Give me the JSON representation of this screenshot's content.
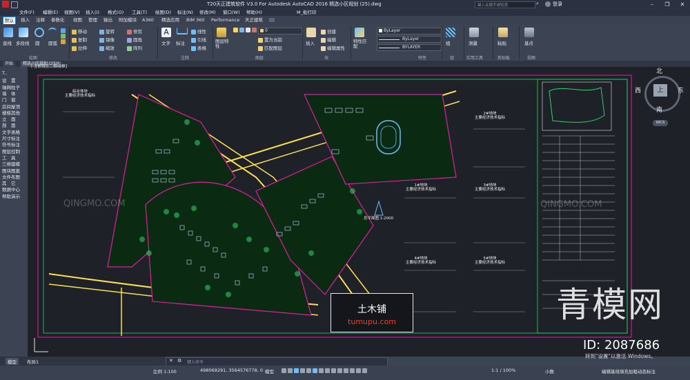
{
  "titlebar": {
    "title": "T20天正建筑软件 V3.0 For Autodesk AutoCAD 2016    精选小区规划 (25).dwg",
    "search_placeholder": "键入关键字或短语",
    "login": "登录",
    "minimize": "–",
    "maximize": "❐",
    "close": "✕"
  },
  "menubar": [
    "文件(F)",
    "编辑(E)",
    "视图(V)",
    "插入(I)",
    "格式(O)",
    "工具(T)",
    "绘图(D)",
    "标注(N)",
    "修改(M)",
    "窗口(W)",
    "帮助(H)",
    "M_批打印"
  ],
  "tabs": [
    "默认",
    "插入",
    "注释",
    "参数化",
    "视图",
    "管理",
    "输出",
    "附加模块",
    "A360",
    "精选应用",
    "BIM 360",
    "Performance",
    "天正建筑"
  ],
  "ribbon": {
    "draw_tools": [
      {
        "label": "直线",
        "icon": "line-icon"
      },
      {
        "label": "多段线",
        "icon": "polyline-icon"
      },
      {
        "label": "圆",
        "icon": "circle-icon"
      },
      {
        "label": "圆弧",
        "icon": "arc-icon"
      }
    ],
    "modify_tools": [
      [
        "移动",
        "旋转",
        "修剪"
      ],
      [
        "复制",
        "镜像",
        "圆角"
      ],
      [
        "拉伸",
        "缩放",
        "阵列"
      ]
    ],
    "annotation_tools": [
      {
        "label": "文字",
        "icon": "text-icon"
      },
      {
        "label": "标注",
        "icon": "dimension-icon"
      }
    ],
    "annotation_small": [
      "线性",
      "引线",
      "表格"
    ],
    "layer_tools": {
      "big": "图层特性",
      "small": [
        "置为当前",
        "匹配图层"
      ],
      "layer_value": "0"
    },
    "block_tools": {
      "big": "插入",
      "small": [
        "创建",
        "编辑",
        "编辑属性"
      ]
    },
    "properties": {
      "big": "特性匹配",
      "color": "ByLayer",
      "linetype": "ByLayer",
      "lineweight": "BYLAYER"
    },
    "group": {
      "big": "组"
    },
    "utilities": {
      "big": "测量"
    },
    "clipboard": {
      "big": "粘贴"
    },
    "base": {
      "big": "基点"
    },
    "groups": [
      "绘图",
      "修改",
      "注释",
      "图层",
      "块",
      "特性",
      "组",
      "实用工具",
      "剪贴板",
      "视图"
    ]
  },
  "doctabs": [
    "开始",
    "精选小区规划 (25)*"
  ],
  "viewport_label": "[-][俯视][二维线框]",
  "palette": [
    "T..",
    "设　置",
    "轴网柱子",
    "墙　体",
    "门　窗",
    "房间屋顶",
    "楼梯其他",
    "立　面",
    "剖　面",
    "文字表格",
    "尺寸标注",
    "符号标注",
    "图层控制",
    "工　具",
    "三维建模",
    "图块图案",
    "文件布图",
    "其　它",
    "数据中心",
    "帮助演示"
  ],
  "viewcube": {
    "north": "北",
    "south": "南",
    "east": "东",
    "west": "西",
    "top": "上",
    "wcs": "WCS"
  },
  "drawing": {
    "table_titles": [
      "综合体块\n主要经济技术指标",
      "1#地块\n主要经济技术指标",
      "2#地块\n主要经济技术指标",
      "3#地块\n主要经济技术指标",
      "4#地块\n主要经济技术指标",
      "5#地块\n主要经济技术指标"
    ],
    "scale_note": "总平面图  1:2000",
    "stamp_cn": "土木铺",
    "stamp_url": "tumupu.com"
  },
  "watermarks": {
    "qingmo": "QINGMO.COM",
    "brand": "青模网",
    "id": "ID: 2087686",
    "activate": "转到\"设置\"以激活 Windows。"
  },
  "layout_tabs": [
    "模型",
    "布局1"
  ],
  "command_placeholder": "键入命令",
  "status": {
    "scale": "比例 1:100",
    "coords": "498069291, 3564576778, 0",
    "model": "模型",
    "anno_scale": "1:1 / 100%",
    "units": "小数",
    "right_text": "编辑基线填充加粗动态标注"
  }
}
